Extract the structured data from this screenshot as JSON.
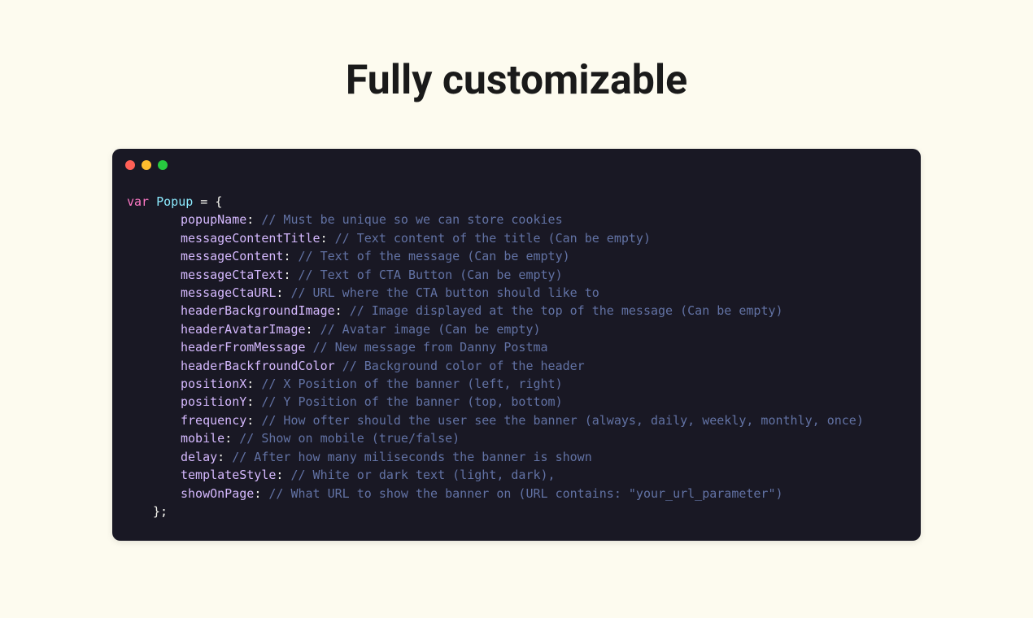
{
  "page": {
    "title": "Fully customizable"
  },
  "code": {
    "declaration_keyword": "var",
    "object_name": "Popup",
    "equals_open": " = {",
    "close": "};",
    "lines": [
      {
        "prop": "popupName",
        "colon": ":",
        "comment": "// Must be unique so we can store cookies"
      },
      {
        "prop": "messageContentTitle",
        "colon": ":",
        "comment": "// Text content of the title (Can be empty)"
      },
      {
        "prop": "messageContent",
        "colon": ":",
        "comment": "// Text of the message (Can be empty)"
      },
      {
        "prop": "messageCtaText",
        "colon": ":",
        "comment": "// Text of CTA Button (Can be empty)"
      },
      {
        "prop": "messageCtaURL",
        "colon": ":",
        "comment": "// URL where the CTA button should like to"
      },
      {
        "prop": "headerBackgroundImage",
        "colon": ":",
        "comment": "// Image displayed at the top of the message (Can be empty)"
      },
      {
        "prop": "headerAvatarImage",
        "colon": ":",
        "comment": "// Avatar image (Can be empty)"
      },
      {
        "prop": "headerFromMessage",
        "colon": "",
        "comment": "// New message from Danny Postma"
      },
      {
        "prop": "headerBackfroundColor",
        "colon": "",
        "comment": "// Background color of the header"
      },
      {
        "prop": "positionX",
        "colon": ":",
        "comment": "// X Position of the banner (left, right)"
      },
      {
        "prop": "positionY",
        "colon": ":",
        "comment": "// Y Position of the banner (top, bottom)"
      },
      {
        "prop": "frequency",
        "colon": ":",
        "comment": "// How ofter should the user see the banner (always, daily, weekly, monthly, once)"
      },
      {
        "prop": "mobile",
        "colon": ":",
        "comment": "// Show on mobile (true/false)"
      },
      {
        "prop": "delay",
        "colon": ":",
        "comment": "// After how many miliseconds the banner is shown"
      },
      {
        "prop": "templateStyle",
        "colon": ":",
        "comment": "// White or dark text (light, dark),"
      },
      {
        "prop": "showOnPage",
        "colon": ":",
        "comment": "// What URL to show the banner on (URL contains: \"your_url_parameter\")"
      }
    ]
  }
}
